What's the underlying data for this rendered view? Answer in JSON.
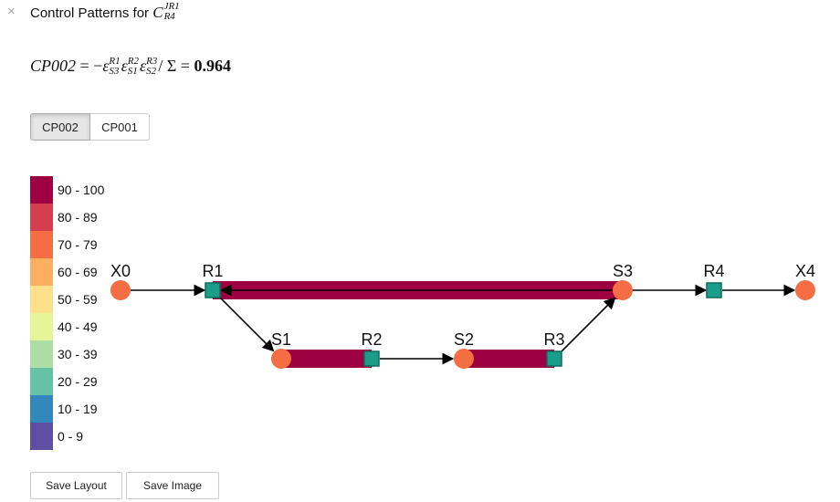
{
  "header": {
    "close_glyph": "×",
    "title_prefix": "Control Patterns for ",
    "title_var": "C",
    "title_sup": "JR1",
    "title_sub": "R4"
  },
  "equation": {
    "lhs": "CP002",
    "eq": "=",
    "neg": "−",
    "eps": "ε",
    "terms": [
      {
        "sup": "R1",
        "sub": "S3"
      },
      {
        "sup": "R2",
        "sub": "S1"
      },
      {
        "sup": "R3",
        "sub": "S2"
      }
    ],
    "tail": "/ Σ",
    "eq2": "=",
    "value": "0.964"
  },
  "tabs": [
    {
      "label": "CP002",
      "active": true
    },
    {
      "label": "CP001",
      "active": false
    }
  ],
  "legend": [
    {
      "label": "90 - 100",
      "color": "#9e0142"
    },
    {
      "label": "80 - 89",
      "color": "#d53e4f"
    },
    {
      "label": "70 - 79",
      "color": "#f46d43"
    },
    {
      "label": "60 - 69",
      "color": "#fdae61"
    },
    {
      "label": "50 - 59",
      "color": "#fee08b"
    },
    {
      "label": "40 - 49",
      "color": "#e6f598"
    },
    {
      "label": "30 - 39",
      "color": "#abdda4"
    },
    {
      "label": "20 - 29",
      "color": "#66c2a5"
    },
    {
      "label": "10 - 19",
      "color": "#3288bd"
    },
    {
      "label": "0 - 9",
      "color": "#5e4fa2"
    }
  ],
  "network": {
    "species_color": "#f46d43",
    "reaction_color": "#1a9e8a",
    "reaction_border": "#0e6b5d",
    "highlight_color": "#9e0142",
    "nodes": [
      {
        "id": "X0",
        "label": "X0",
        "kind": "species"
      },
      {
        "id": "R1",
        "label": "R1",
        "kind": "reaction"
      },
      {
        "id": "S3",
        "label": "S3",
        "kind": "species"
      },
      {
        "id": "R4",
        "label": "R4",
        "kind": "reaction"
      },
      {
        "id": "X4",
        "label": "X4",
        "kind": "species"
      },
      {
        "id": "S1",
        "label": "S1",
        "kind": "species"
      },
      {
        "id": "R2",
        "label": "R2",
        "kind": "reaction"
      },
      {
        "id": "S2",
        "label": "S2",
        "kind": "species"
      },
      {
        "id": "R3",
        "label": "R3",
        "kind": "reaction"
      }
    ]
  },
  "buttons": {
    "save_layout": "Save Layout",
    "save_image": "Save Image"
  }
}
